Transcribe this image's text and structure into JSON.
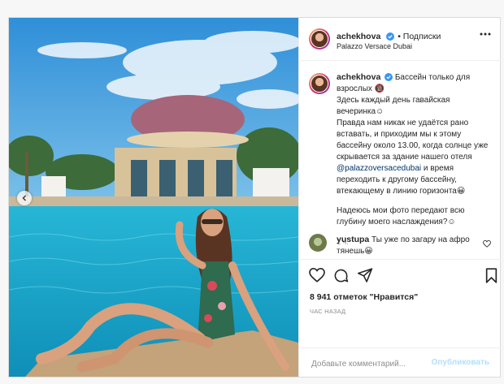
{
  "header": {
    "username": "achekhova",
    "follow_label": "• Подписки",
    "location": "Palazzo Versace Dubai"
  },
  "caption": {
    "username": "achekhova",
    "text_intro": "Бассейн только для взрослых 🔞",
    "line2": "Здесь каждый день гавайская вечеринка☺",
    "line3_before": "Правда нам никак не удаётся рано вставать, и приходим мы к этому бассейну около 13.00, когда солнце уже скрывается за здание нашего отеля ",
    "mention": "@palazzoversacedubai",
    "line3_after": " и время переходить к другому бассейну, втекающему в линию горизонта😀",
    "line4": "Надеюсь мои фото передают всю глубину моего наслаждения?☺",
    "age": "1 ч."
  },
  "comments": [
    {
      "username": "yustupa",
      "text": "Ты уже по загару на афро тянешь😀"
    }
  ],
  "likes": "8 941 отметок \"Нравится\"",
  "time_ago": "ЧАС НАЗАД",
  "comment_form": {
    "placeholder": "Добавьте комментарий...",
    "publish_label": "Опубликовать"
  },
  "icons": {
    "like": "heart-icon",
    "comment": "speech-bubble-icon",
    "share": "paper-plane-icon",
    "save": "bookmark-icon",
    "more": "ellipsis-icon",
    "verified": "verified-badge-icon",
    "prev": "chevron-left-icon"
  },
  "colors": {
    "link": "#00376b",
    "verified": "#3897f0",
    "muted": "#8e8e8e",
    "publish_disabled": "#b2dffc"
  }
}
